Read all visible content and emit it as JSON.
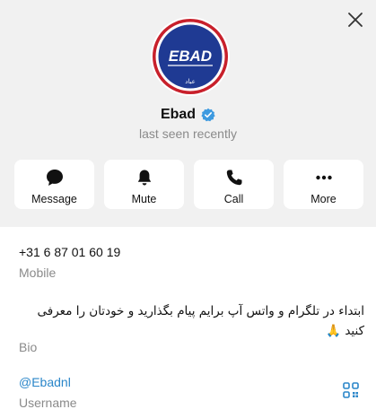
{
  "profile": {
    "name": "Ebad",
    "status": "last seen recently",
    "avatar_text": "EBAD",
    "avatar_sub": "عباد"
  },
  "actions": [
    {
      "label": "Message",
      "icon": "chat-bubble-icon"
    },
    {
      "label": "Mute",
      "icon": "bell-icon"
    },
    {
      "label": "Call",
      "icon": "phone-icon"
    },
    {
      "label": "More",
      "icon": "more-dots-icon"
    }
  ],
  "info": {
    "phone": "+31 6 87 01 60 19",
    "phone_caption": "Mobile",
    "bio": "ابتداء در تلگرام و واتس آپ برایم پیام بگذارید و خودتان را معرفی کنید 🙏",
    "bio_caption": "Bio",
    "username": "@Ebadnl",
    "username_caption": "Username"
  },
  "colors": {
    "header_bg": "#f1f1f1",
    "accent": "#2a86c9",
    "verified": "#3d9ae0",
    "avatar_ring": "#c8202b",
    "avatar_fill": "#1f3a93"
  }
}
